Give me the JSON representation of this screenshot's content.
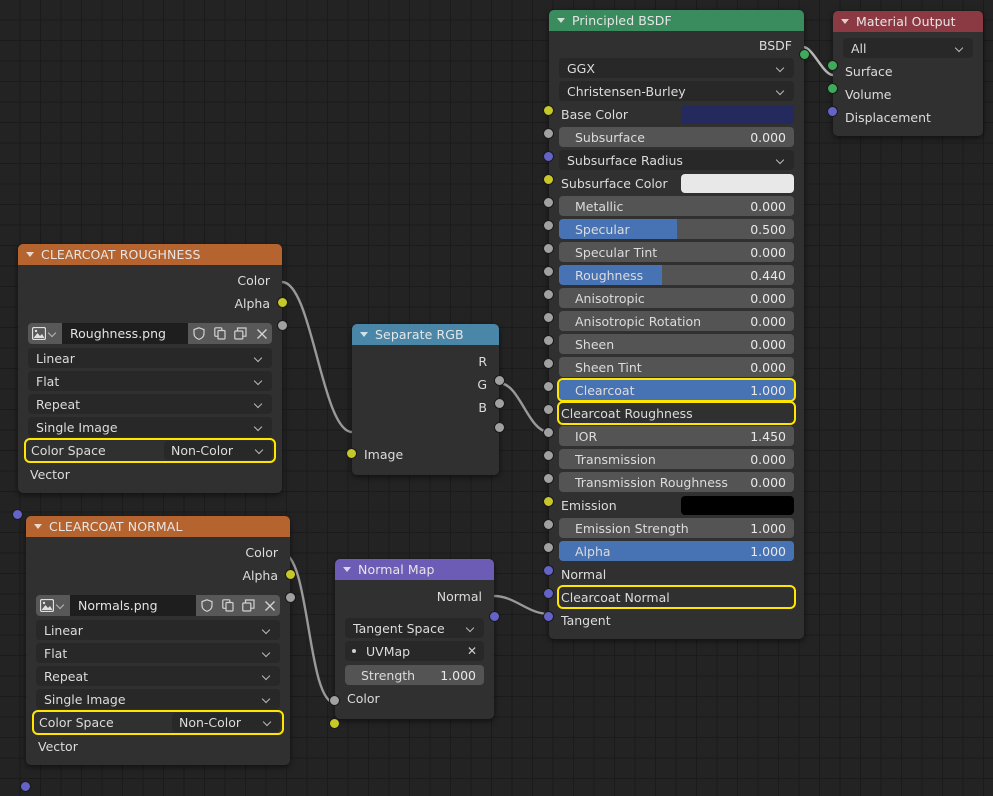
{
  "editor": {
    "name": "blender-shader-node-editor",
    "background": "#232323",
    "grid_color": "#1b1b1b"
  },
  "colors": {
    "header_green": "#3a8b5d",
    "header_red": "#8b3a43",
    "header_orange": "#b6642f",
    "header_blue": "#4a86a8",
    "header_purple": "#6c5cb5",
    "highlight_yellow": "#ffe600",
    "slider_fill": "#4772b3",
    "socket_yellow": "#c7c729",
    "socket_gray": "#a1a1a1",
    "socket_purple": "#6363c8",
    "socket_green": "#3fab5a"
  },
  "nodes": {
    "principled_bsdf": {
      "title": "Principled BSDF",
      "output_label": "BSDF",
      "distribution": "GGX",
      "subsurface_method": "Christensen-Burley",
      "rows": [
        {
          "label": "Base Color",
          "type": "color",
          "value": "#252a5e",
          "socket": "yellow"
        },
        {
          "label": "Subsurface",
          "type": "slider",
          "value": "0.000",
          "fill": 0,
          "socket": "gray",
          "indent": true
        },
        {
          "label": "Subsurface Radius",
          "type": "dropdown",
          "value": "",
          "socket": "purple"
        },
        {
          "label": "Subsurface Color",
          "type": "color",
          "value": "#e8e8e8",
          "socket": "yellow"
        },
        {
          "label": "Metallic",
          "type": "slider",
          "value": "0.000",
          "fill": 0,
          "socket": "gray",
          "indent": true
        },
        {
          "label": "Specular",
          "type": "slider",
          "value": "0.500",
          "fill": 50,
          "socket": "gray",
          "indent": true
        },
        {
          "label": "Specular Tint",
          "type": "slider",
          "value": "0.000",
          "fill": 0,
          "socket": "gray",
          "indent": true
        },
        {
          "label": "Roughness",
          "type": "slider",
          "value": "0.440",
          "fill": 44,
          "socket": "gray",
          "indent": true
        },
        {
          "label": "Anisotropic",
          "type": "slider",
          "value": "0.000",
          "fill": 0,
          "socket": "gray",
          "indent": true
        },
        {
          "label": "Anisotropic Rotation",
          "type": "slider",
          "value": "0.000",
          "fill": 0,
          "socket": "gray",
          "indent": true
        },
        {
          "label": "Sheen",
          "type": "slider",
          "value": "0.000",
          "fill": 0,
          "socket": "gray",
          "indent": true
        },
        {
          "label": "Sheen Tint",
          "type": "slider",
          "value": "0.000",
          "fill": 0,
          "socket": "gray",
          "indent": true
        },
        {
          "label": "Clearcoat",
          "type": "slider",
          "value": "1.000",
          "fill": 100,
          "socket": "gray",
          "indent": true,
          "highlight": true
        },
        {
          "label": "Clearcoat Roughness",
          "type": "linked",
          "value": "",
          "socket": "gray",
          "highlight": true
        },
        {
          "label": "IOR",
          "type": "slider",
          "value": "1.450",
          "fill": 0,
          "socket": "gray",
          "indent": true
        },
        {
          "label": "Transmission",
          "type": "slider",
          "value": "0.000",
          "fill": 0,
          "socket": "gray",
          "indent": true
        },
        {
          "label": "Transmission Roughness",
          "type": "slider",
          "value": "0.000",
          "fill": 0,
          "socket": "gray",
          "indent": true
        },
        {
          "label": "Emission",
          "type": "color",
          "value": "#000000",
          "socket": "yellow"
        },
        {
          "label": "Emission Strength",
          "type": "slider",
          "value": "1.000",
          "fill": 0,
          "socket": "gray",
          "indent": true
        },
        {
          "label": "Alpha",
          "type": "slider",
          "value": "1.000",
          "fill": 100,
          "socket": "gray",
          "indent": true
        },
        {
          "label": "Normal",
          "type": "plain",
          "value": "",
          "socket": "purple"
        },
        {
          "label": "Clearcoat Normal",
          "type": "linked",
          "value": "",
          "socket": "purple",
          "highlight": true
        },
        {
          "label": "Tangent",
          "type": "plain",
          "value": "",
          "socket": "purple"
        }
      ]
    },
    "material_output": {
      "title": "Material Output",
      "target": "All",
      "inputs": [
        {
          "label": "Surface",
          "socket": "green"
        },
        {
          "label": "Volume",
          "socket": "green"
        },
        {
          "label": "Displacement",
          "socket": "purple"
        }
      ]
    },
    "clearcoat_roughness_tex": {
      "title": "CLEARCOAT ROUGHNESS",
      "outputs": [
        {
          "label": "Color",
          "socket": "yellow"
        },
        {
          "label": "Alpha",
          "socket": "gray"
        }
      ],
      "image_name": "Roughness.png",
      "interpolation": "Linear",
      "projection": "Flat",
      "extension": "Repeat",
      "source": "Single Image",
      "color_space_label": "Color Space",
      "color_space_value": "Non-Color",
      "vector_label": "Vector",
      "toolbar_icons": [
        "image-icon",
        "dropdown-icon",
        "shield-icon",
        "copy-icon",
        "pack-icon",
        "close-icon"
      ]
    },
    "clearcoat_normal_tex": {
      "title": "CLEARCOAT NORMAL",
      "outputs": [
        {
          "label": "Color",
          "socket": "yellow"
        },
        {
          "label": "Alpha",
          "socket": "gray"
        }
      ],
      "image_name": "Normals.png",
      "interpolation": "Linear",
      "projection": "Flat",
      "extension": "Repeat",
      "source": "Single Image",
      "color_space_label": "Color Space",
      "color_space_value": "Non-Color",
      "vector_label": "Vector",
      "toolbar_icons": [
        "image-icon",
        "dropdown-icon",
        "shield-icon",
        "copy-icon",
        "pack-icon",
        "close-icon"
      ]
    },
    "separate_rgb": {
      "title": "Separate RGB",
      "outputs": [
        {
          "label": "R",
          "socket": "gray"
        },
        {
          "label": "G",
          "socket": "gray"
        },
        {
          "label": "B",
          "socket": "gray"
        }
      ],
      "inputs": [
        {
          "label": "Image",
          "socket": "yellow"
        }
      ]
    },
    "normal_map": {
      "title": "Normal Map",
      "output_label": "Normal",
      "space": "Tangent Space",
      "uv_map": "UVMap",
      "strength_label": "Strength",
      "strength_value": "1.000",
      "color_label": "Color"
    }
  }
}
